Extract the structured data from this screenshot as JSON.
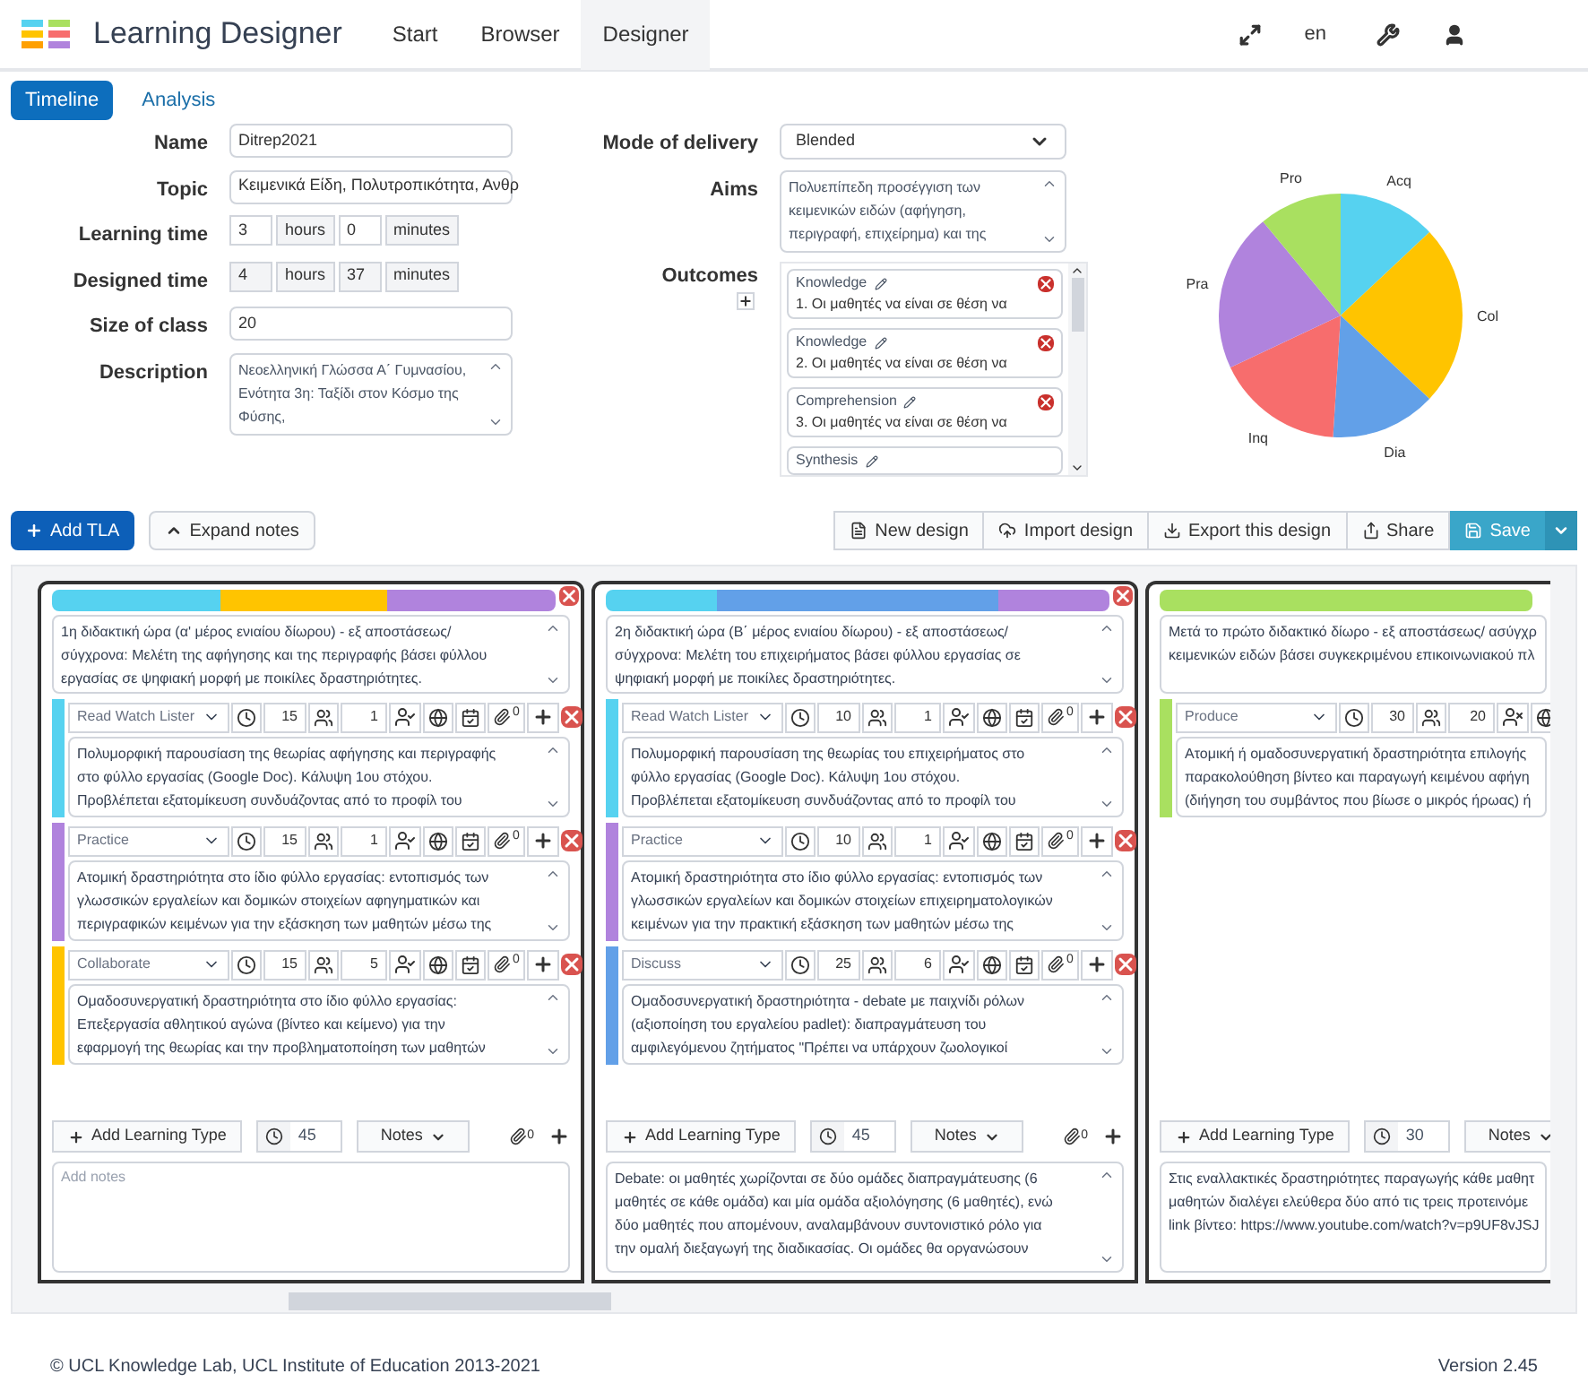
{
  "app": {
    "title": "Learning Designer"
  },
  "nav": [
    {
      "label": "Start",
      "selected": false
    },
    {
      "label": "Browser",
      "selected": false
    },
    {
      "label": "Designer",
      "selected": true
    }
  ],
  "header_right": {
    "language": "en"
  },
  "tabs": [
    {
      "label": "Timeline",
      "selected": true
    },
    {
      "label": "Analysis",
      "selected": false
    }
  ],
  "form": {
    "fields": [
      {
        "kind": "text",
        "label": "Name",
        "value": "Ditrep2021"
      },
      {
        "kind": "text",
        "label": "Topic",
        "value": "Κειμενικά Είδη, Πολυτροπικότητα, Ανθρ"
      },
      {
        "kind": "time",
        "label": "Learning time",
        "hours": "3",
        "hours_unit": "hours",
        "minutes": "0",
        "minutes_unit": "minutes",
        "disabled": false
      },
      {
        "kind": "time",
        "label": "Designed time",
        "hours": "4",
        "hours_unit": "hours",
        "minutes": "37",
        "minutes_unit": "minutes",
        "disabled": true
      },
      {
        "kind": "text",
        "label": "Size of class",
        "value": "20"
      },
      {
        "kind": "textarea",
        "label": "Description",
        "lines": [
          "Νεοελληνική Γλώσσα Α΄ Γυμνασίου,",
          "Ενότητα 3η: Ταξίδι στον Κόσμο της",
          "Φύσης,"
        ]
      }
    ],
    "mode": {
      "label": "Mode of delivery",
      "value": "Blended"
    },
    "aims": {
      "label": "Aims",
      "lines": [
        "Πολυεπίπεδη προσέγγιση των",
        "κειμενικών ειδών (αφήγηση,",
        "περιγραφή, επιχείρημα) και της"
      ]
    },
    "outcomes": {
      "label": "Outcomes",
      "items": [
        {
          "category": "Knowledge",
          "text": "1. Οι μαθητές να είναι σε θέση να"
        },
        {
          "category": "Knowledge",
          "text": "2. Οι μαθητές να είναι σε θέση να"
        },
        {
          "category": "Comprehension",
          "text": "3. Οι μαθητές να είναι σε θέση να"
        },
        {
          "category": "Synthesis"
        }
      ]
    }
  },
  "chart_data": {
    "type": "pie",
    "categories": [
      "Acq",
      "Col",
      "Dia",
      "Inq",
      "Pra",
      "Pro"
    ],
    "colors": [
      "#56d2f0",
      "#ffc400",
      "#62a0e8",
      "#f76d6d",
      "#b083dd",
      "#a9e060"
    ],
    "series": [
      {
        "values": [
          13,
          24,
          14,
          17,
          21,
          11
        ]
      }
    ]
  },
  "toolbar": {
    "left": [
      "Add TLA",
      "Expand notes"
    ],
    "right": [
      "New design",
      "Import design",
      "Export this design",
      "Share"
    ],
    "save": "Save"
  },
  "columns": [
    {
      "cut": false,
      "bar": [
        {
          "color": "#56d2f0"
        },
        {
          "color": "#ffc400"
        },
        {
          "color": "#b083dd"
        }
      ],
      "description": [
        "1η διδακτική ώρα (α' μέρος ενιαίου δίωρου) - εξ αποστάσεως/",
        "σύγχρονα: Μελέτη της αφήγησης και της περιγραφής βάσει φύλλου",
        "εργασίας σε ψηφιακή μορφή με ποικίλες δραστηριότητες."
      ],
      "activities": [
        {
          "type": "Read Watch Lister",
          "color": "#56d2f0",
          "minutes": "15",
          "group_size": "1",
          "person_ok": true,
          "attachments": "0",
          "lines": [
            "Πολυμορφική παρουσίαση της θεωρίας αφήγησης και περιγραφής",
            "στο φύλλο εργασίας (Google Doc). Κάλυψη 1ου στόχου.",
            "Προβλέπεται εξατομίκευση συνδυάζοντας από το προφίλ του"
          ]
        },
        {
          "type": "Practice",
          "color": "#b083dd",
          "minutes": "15",
          "group_size": "1",
          "person_ok": true,
          "attachments": "0",
          "lines": [
            "Ατομική δραστηριότητα στο ίδιο φύλλο εργασίας: εντοπισμός των",
            "γλωσσικών εργαλείων και δομικών στοιχείων αφηγηματικών και",
            "περιγραφικών κειμένων για την εξάσκηση των μαθητών μέσω της"
          ]
        },
        {
          "type": "Collaborate",
          "color": "#ffc400",
          "minutes": "15",
          "group_size": "5",
          "person_ok": true,
          "attachments": "0",
          "lines": [
            "Ομαδοσυνεργατική δραστηριότητα στο ίδιο φύλλο εργασίας:",
            "Επεξεργασία αθλητικού αγώνα (βίντεο και κείμενο) για την",
            "εφαρμογή της θεωρίας και την προβληματοποίηση των μαθητών"
          ]
        }
      ],
      "add_label": "Add Learning Type",
      "total": "45",
      "notes_label": "Notes",
      "attachments": "0",
      "notes_placeholder": "Add notes"
    },
    {
      "cut": false,
      "bar": [
        {
          "color": "#56d2f0"
        },
        {
          "color": "#62a0e8"
        },
        {
          "color": "#b083dd"
        }
      ],
      "description": [
        "2η διδακτική ώρα (Β΄ μέρος ενιαίου δίωρου) - εξ αποστάσεως/",
        "σύγχρονα: Μελέτη του επιχειρήματος βάσει φύλλου εργασίας σε",
        "ψηφιακή μορφή με ποικίλες δραστηριότητες."
      ],
      "activities": [
        {
          "type": "Read Watch Lister",
          "color": "#56d2f0",
          "minutes": "10",
          "group_size": "1",
          "person_ok": true,
          "attachments": "0",
          "lines": [
            "Πολυμορφική παρουσίαση της θεωρίας του επιχειρήματος στο",
            "φύλλο εργασίας (Google Doc). Κάλυψη 1ου στόχου.",
            "Προβλέπεται εξατομίκευση συνδυάζοντας από το προφίλ του"
          ]
        },
        {
          "type": "Practice",
          "color": "#b083dd",
          "minutes": "10",
          "group_size": "1",
          "person_ok": true,
          "attachments": "0",
          "lines": [
            "Ατομική δραστηριότητα στο ίδιο φύλλο εργασίας: εντοπισμός των",
            "γλωσσικών εργαλείων και δομικών στοιχείων επιχειρηματολογικών",
            "κειμένων για την πρακτική εξάσκηση των μαθητών μέσω της"
          ]
        },
        {
          "type": "Discuss",
          "color": "#62a0e8",
          "minutes": "25",
          "group_size": "6",
          "person_ok": true,
          "attachments": "0",
          "lines": [
            "Ομαδοσυνεργατική δραστηριότητα - debate με παιχνίδι ρόλων",
            "(αξιοποίηση του εργαλείου padlet): διαπραγμάτευση του",
            "αμφιλεγόμενου ζητήματος \"Πρέπει να υπάρχουν ζωολογικοί"
          ]
        }
      ],
      "add_label": "Add Learning Type",
      "total": "45",
      "notes_label": "Notes",
      "attachments": "0",
      "notes": [
        "Debate: οι μαθητές χωρίζονται σε δύο ομάδες διαπραγμάτευσης (6",
        "μαθητές σε κάθε ομάδα)  και μία ομάδα αξιολόγησης (6 μαθητές), ενώ",
        "δύο μαθητές που απομένουν, αναλαμβάνουν συντονιστικό ρόλο για",
        "την ομαλή διεξαγωγή της διαδικασίας. Οι ομάδες θα οργανώσουν"
      ]
    },
    {
      "cut": true,
      "bar": [
        {
          "color": "#a9e060"
        }
      ],
      "description": [
        "Μετά το πρώτο διδακτικό δίωρο - εξ αποστάσεως/ ασύγχρ",
        "κειμενικών ειδών βάσει συγκεκριμένου επικοινωνιακού πλ"
      ],
      "activities": [
        {
          "type": "Produce",
          "color": "#a9e060",
          "minutes": "30",
          "group_size": "20",
          "person_ok": false,
          "lines": [
            "Ατομική ή ομαδοσυνεργατική δραστηριότητα επιλογής",
            "παρακολούθηση βίντεο και παραγωγή κειμένου αφήγη",
            "(διήγηση του συμβάντος που βίωσε ο μικρός ήρωας) ή"
          ]
        }
      ],
      "add_label": "Add Learning Type",
      "total": "30",
      "notes_label": "Notes",
      "notes": [
        "Στις εναλλακτικές δραστηριότητες παραγωγής κάθε μαθητ",
        "μαθητών διαλέγει ελεύθερα δύο από τις τρεις προτεινόμε",
        "link βίντεο: https://www.youtube.com/watch?v=p9UF8vJSJ"
      ]
    }
  ],
  "footer": {
    "copyright": "© UCL Knowledge Lab, UCL Institute of Education 2013-2021",
    "version": "Version 2.45"
  }
}
